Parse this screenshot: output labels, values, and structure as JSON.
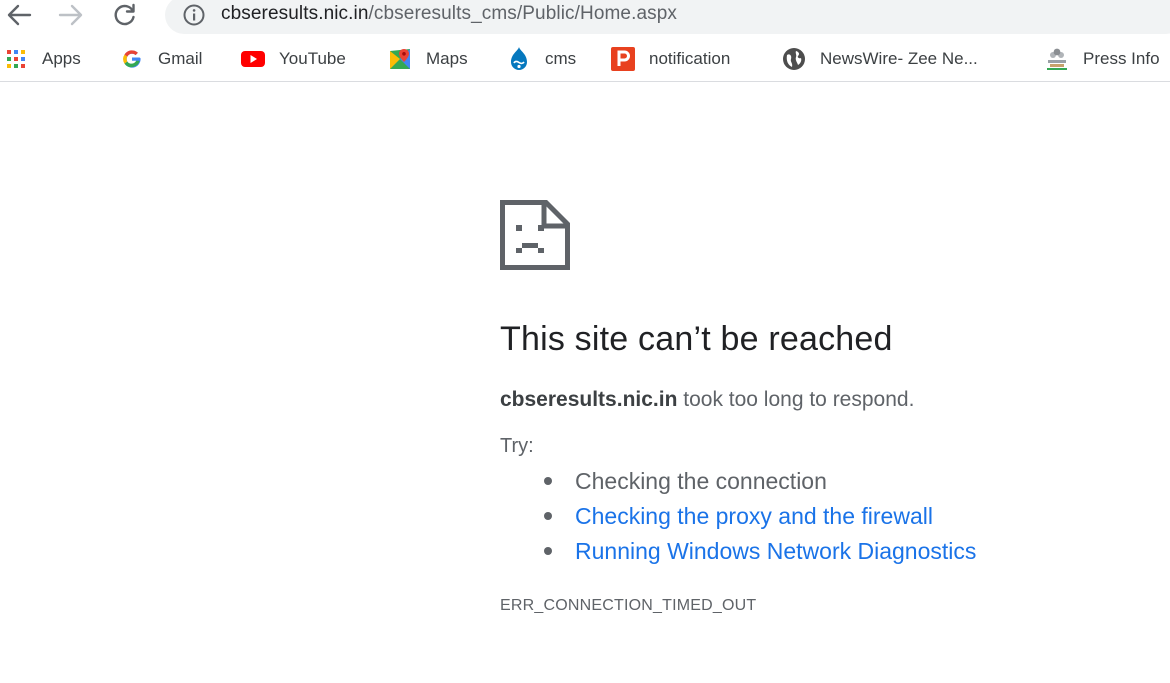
{
  "toolbar": {
    "back_icon": "arrow-left-icon",
    "forward_icon": "arrow-right-icon",
    "reload_icon": "reload-icon",
    "info_icon": "info-icon",
    "url_host": "cbseresults.nic.in",
    "url_path": "/cbseresults_cms/Public/Home.aspx"
  },
  "bookmarks": [
    {
      "label": "Apps",
      "icon": "apps-grid-icon"
    },
    {
      "label": "Gmail",
      "icon": "google-g-icon"
    },
    {
      "label": "YouTube",
      "icon": "youtube-icon"
    },
    {
      "label": "Maps",
      "icon": "maps-icon"
    },
    {
      "label": "cms",
      "icon": "drupal-icon"
    },
    {
      "label": "notification",
      "icon": "p-icon"
    },
    {
      "label": "NewsWire- Zee Ne...",
      "icon": "globe-icon"
    },
    {
      "label": "Press Info",
      "icon": "emblem-icon"
    }
  ],
  "error": {
    "icon": "sad-page-icon",
    "title": "This site can’t be reached",
    "host": "cbseresults.nic.in",
    "message": "took too long to respond.",
    "try_label": "Try:",
    "suggestions": [
      {
        "text": "Checking the connection",
        "is_link": false
      },
      {
        "text": "Checking the proxy and the firewall",
        "is_link": true
      },
      {
        "text": "Running Windows Network Diagnostics",
        "is_link": true
      }
    ],
    "code": "ERR_CONNECTION_TIMED_OUT"
  },
  "colors": {
    "link": "#1a73e8",
    "text_secondary": "#5f6368",
    "omnibox_bg": "#f1f3f4",
    "youtube_red": "#ff0000",
    "p_icon_red": "#e8411f"
  }
}
